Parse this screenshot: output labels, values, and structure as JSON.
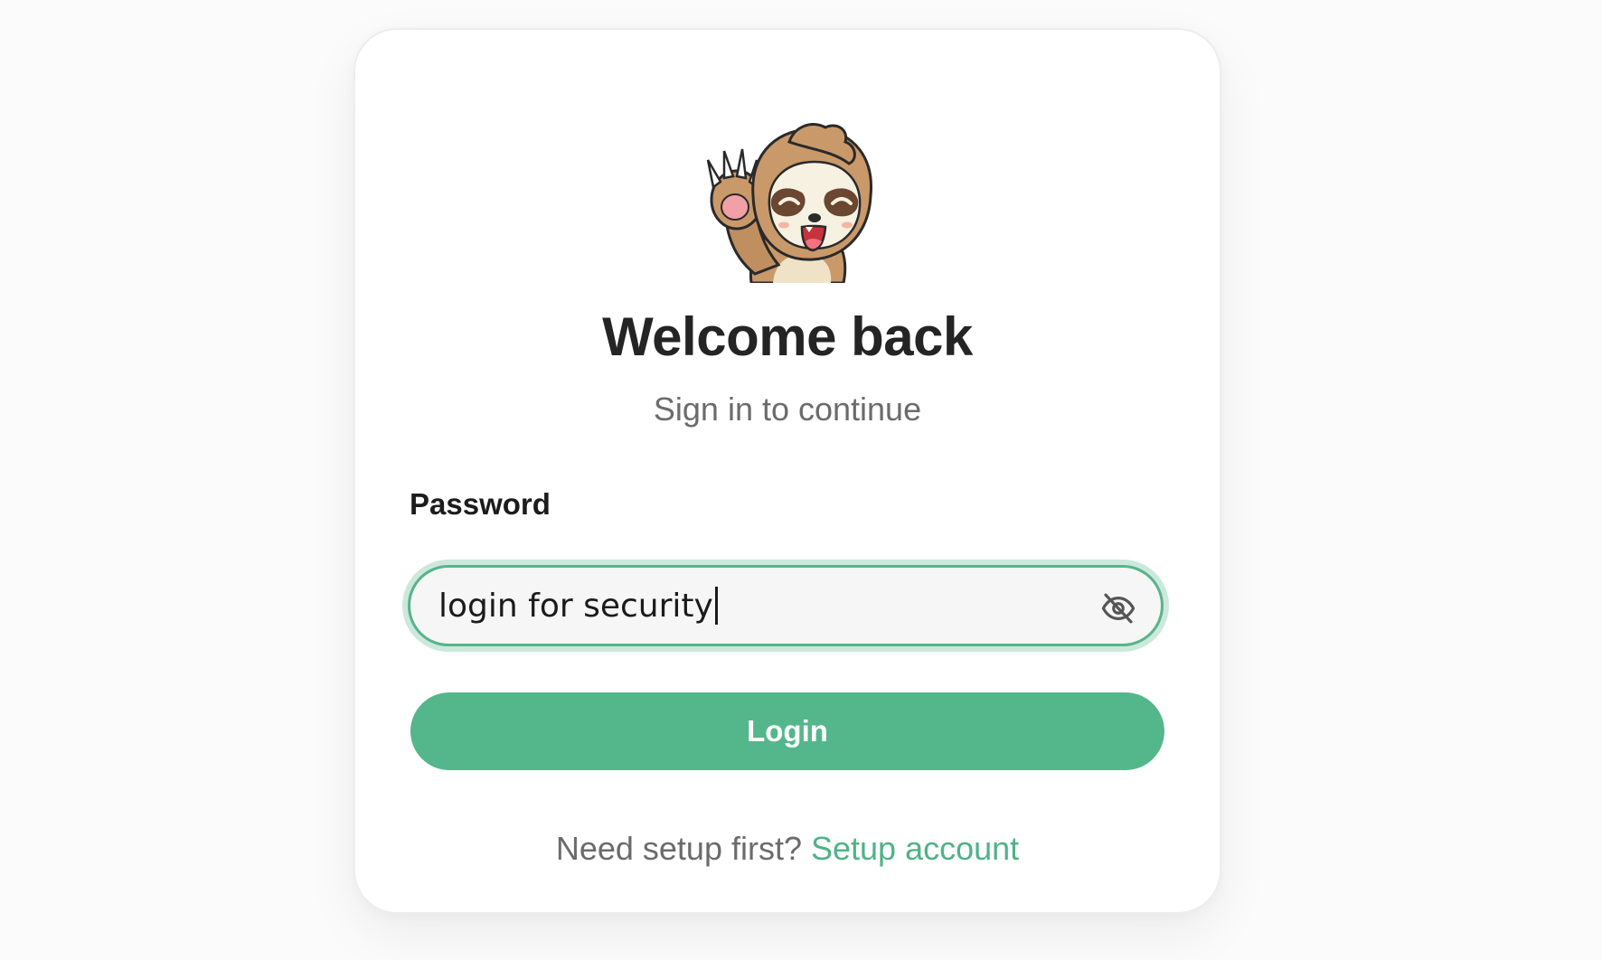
{
  "login": {
    "title": "Welcome back",
    "subtitle": "Sign in to continue",
    "password_label": "Password",
    "password_value": "login for security",
    "password_toggle_icon": "eye-off-icon",
    "login_button": "Login",
    "setup_prompt": "Need setup first?",
    "setup_link": "Setup account"
  },
  "mascot": {
    "icon": "waving-sloth-mascot"
  },
  "colors": {
    "accent": "#54b78c",
    "link": "#4fb386",
    "title": "#242424",
    "muted": "#6b6b6b",
    "background": "#fafbfa",
    "card": "#ffffff"
  }
}
